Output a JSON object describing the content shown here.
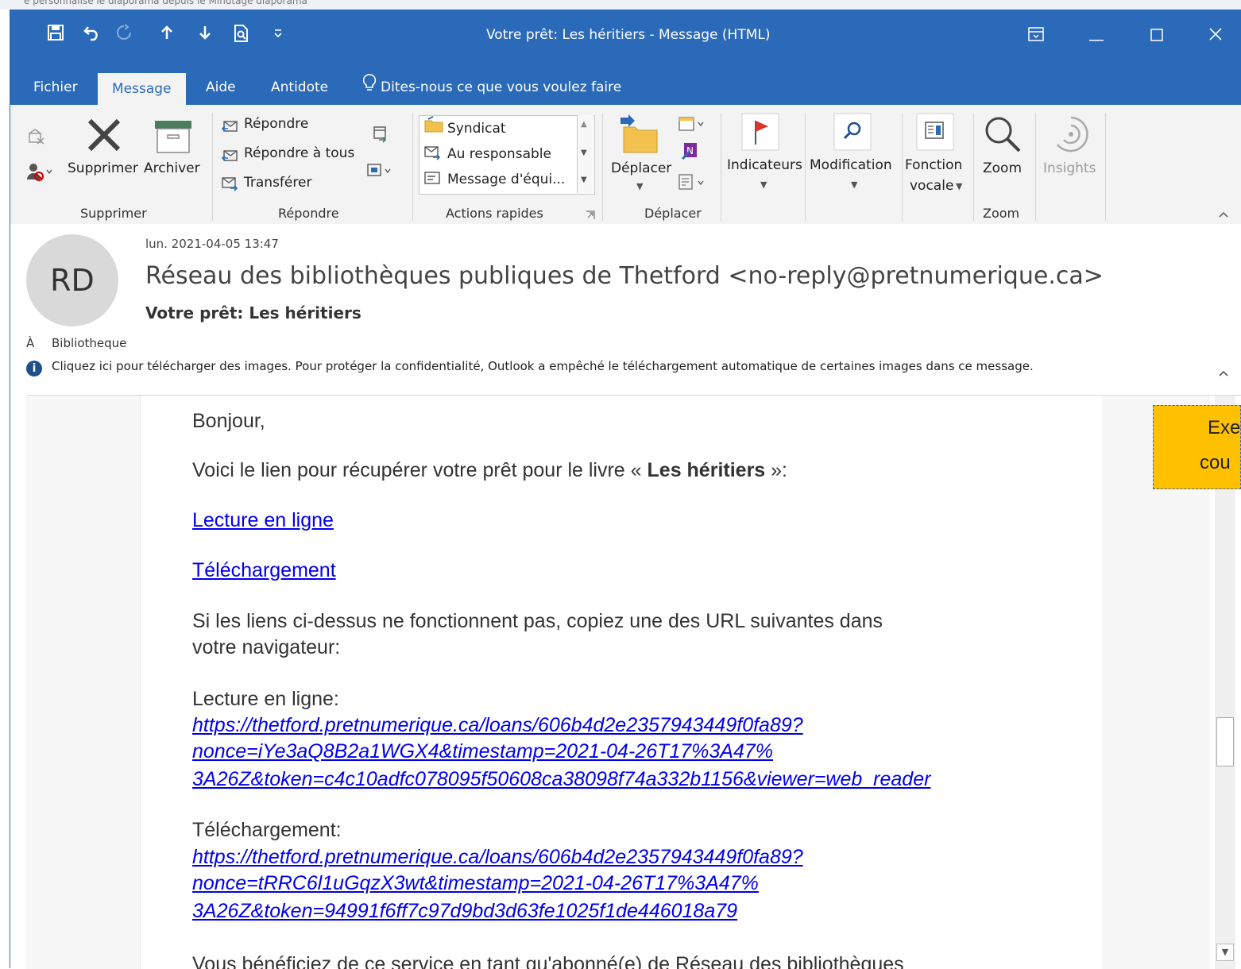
{
  "window": {
    "title": "Votre prêt: Les héritiers  -  Message (HTML)",
    "behind_text": "e    personnalisé       le diaporama depuis le    Minutage diaporama"
  },
  "quick_access": {
    "save_icon": "save-icon",
    "undo_icon": "undo-icon",
    "redo_icon": "redo-icon",
    "up_icon": "arrow-up-icon",
    "down_icon": "arrow-down-icon",
    "preview_icon": "print-preview-icon",
    "customize_icon": "customize-icon"
  },
  "tabs": [
    {
      "label": "Fichier"
    },
    {
      "label": "Message"
    },
    {
      "label": "Aide"
    },
    {
      "label": "Antidote"
    }
  ],
  "tell_me": "Dites-nous ce que vous voulez faire",
  "ribbon": {
    "supprimer": {
      "delete_label": "Supprimer",
      "archive_label": "Archiver",
      "group_label": "Supprimer"
    },
    "repondre": {
      "reply": "Répondre",
      "reply_all": "Répondre à tous",
      "forward": "Transférer",
      "group_label": "Répondre"
    },
    "actions_rapides": {
      "items": [
        "Syndicat",
        "Au responsable",
        "Message d'équi..."
      ],
      "group_label": "Actions rapides"
    },
    "deplacer": {
      "move_label": "Déplacer",
      "group_label": "Déplacer"
    },
    "indicateurs": "Indicateurs",
    "modification": "Modification",
    "fonction_vocale_1": "Fonction",
    "fonction_vocale_2": "vocale",
    "zoom": {
      "zoom_label": "Zoom",
      "group_label": "Zoom"
    },
    "insights": "Insights"
  },
  "message": {
    "avatar_initials": "RD",
    "date": "lun. 2021-04-05 13:47",
    "sender": "Réseau des bibliothèques publiques de Thetford <no-reply@pretnumerique.ca>",
    "subject": "Votre prêt: Les héritiers",
    "to_label": "À",
    "to": "Bibliotheque",
    "info": "Cliquez ici pour télécharger des images. Pour protéger la confidentialité, Outlook a empêché le téléchargement automatique de certaines images dans ce message."
  },
  "body": {
    "greeting": "Bonjour,",
    "intro_before": "Voici le lien pour récupérer votre prêt pour le livre « ",
    "intro_book": "Les héritiers",
    "intro_after": " »:",
    "link_read": "Lecture en ligne",
    "link_download": "Téléchargement",
    "fallback_line1": "Si les liens ci-dessus ne fonctionnent pas, copiez une des URL suivantes dans",
    "fallback_line2": "votre navigateur:",
    "read_label": "Lecture en ligne:",
    "read_url_1": "https://thetford.pretnumerique.ca/loans/606b4d2e2357943449f0fa89?",
    "read_url_2": "nonce=iYe3aQ8B2a1WGX4&timestamp=2021-04-26T17%3A47%",
    "read_url_3": "3A26Z&token=c4c10adfc078095f50608ca38098f74a332b1156&viewer=web_reader",
    "download_label": "Téléchargement:",
    "download_url_1": "https://thetford.pretnumerique.ca/loans/606b4d2e2357943449f0fa89?",
    "download_url_2": "nonce=tRRC6l1uGqzX3wt&timestamp=2021-04-26T17%3A47%",
    "download_url_3": "3A26Z&token=94991f6ff7c97d9bd3d63fe1025f1de446018a79",
    "cut_line": "Vous bénéficiez de ce service en tant qu'abonné(e) de Réseau des bibliothèques"
  },
  "callout": {
    "line1": "Exe",
    "line2": "cou"
  }
}
